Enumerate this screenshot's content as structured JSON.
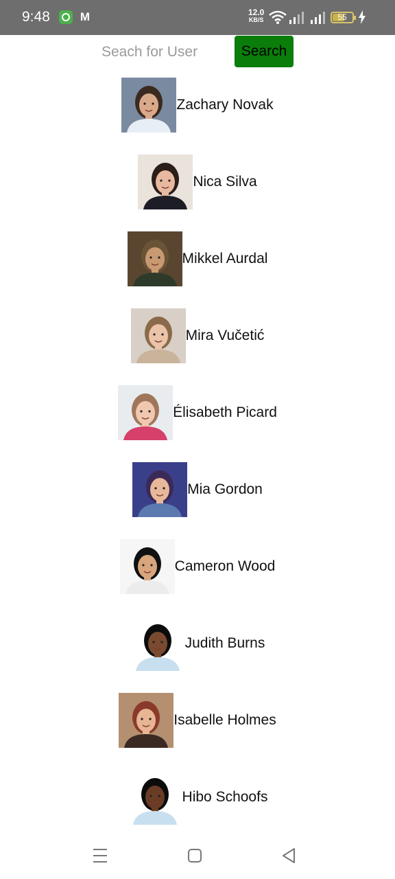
{
  "status_bar": {
    "time": "9:48",
    "net_speed_value": "12.0",
    "net_speed_unit": "KB/S",
    "battery": "55",
    "icons": [
      "app-circle-icon",
      "mail-icon",
      "wifi-icon",
      "signal-icon",
      "signal-icon",
      "battery-icon",
      "charging-bolt-icon"
    ]
  },
  "search": {
    "placeholder": "Seach for User",
    "value": "",
    "button_label": "Search",
    "button_color": "#0a7d0a"
  },
  "users": [
    {
      "name": "Zachary Novak",
      "avatar": {
        "bg": "#7a8aa0",
        "skin": "#d9a98a",
        "hair": "#3b2a20",
        "shirt": "#e8eef5"
      }
    },
    {
      "name": "Nica Silva",
      "avatar": {
        "bg": "#e9e3dc",
        "skin": "#e8b9a0",
        "hair": "#2b1d18",
        "shirt": "#1d1d26"
      }
    },
    {
      "name": "Mikkel Aurdal",
      "avatar": {
        "bg": "#5a4630",
        "skin": "#c99a72",
        "hair": "#6a5438",
        "shirt": "#2f3b2a"
      }
    },
    {
      "name": "Mira Vučetić",
      "avatar": {
        "bg": "#d8cfc6",
        "skin": "#eac3a8",
        "hair": "#8a6a4a",
        "shirt": "#c9b39a"
      }
    },
    {
      "name": "Élisabeth Picard",
      "avatar": {
        "bg": "#e8ecef",
        "skin": "#f0c8b0",
        "hair": "#a0765a",
        "shirt": "#d6406a"
      }
    },
    {
      "name": "Mia Gordon",
      "avatar": {
        "bg": "#3a3f8a",
        "skin": "#e8b89a",
        "hair": "#3a2a55",
        "shirt": "#5a7ab0"
      }
    },
    {
      "name": "Cameron Wood",
      "avatar": {
        "bg": "#f6f6f6",
        "skin": "#d8a57c",
        "hair": "#111111",
        "shirt": "#ececec"
      }
    },
    {
      "name": "Judith Burns",
      "avatar": {
        "bg": "#ffffff",
        "skin": "#7a4a30",
        "hair": "#0c0c0c",
        "shirt": "#c8dff0"
      }
    },
    {
      "name": "Isabelle Holmes",
      "avatar": {
        "bg": "#b49070",
        "skin": "#e8b594",
        "hair": "#8a3a2a",
        "shirt": "#3a2a22"
      }
    },
    {
      "name": "Hibo Schoofs",
      "avatar": {
        "bg": "#ffffff",
        "skin": "#6a3c26",
        "hair": "#0c0c0c",
        "shirt": "#c8dff0"
      }
    }
  ],
  "nav_bar": {
    "icons": [
      "menu-icon",
      "home-icon",
      "back-icon"
    ]
  }
}
